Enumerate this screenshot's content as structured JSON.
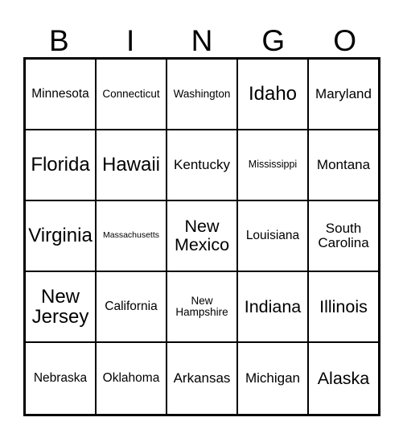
{
  "card": {
    "header": {
      "letters": [
        "B",
        "I",
        "N",
        "G",
        "O"
      ]
    },
    "rows": [
      [
        {
          "label": "Minnesota",
          "size": "m"
        },
        {
          "label": "Connecticut",
          "size": "s"
        },
        {
          "label": "Washington",
          "size": "s"
        },
        {
          "label": "Idaho",
          "size": "xxl"
        },
        {
          "label": "Maryland",
          "size": "ml"
        }
      ],
      [
        {
          "label": "Florida",
          "size": "xxl"
        },
        {
          "label": "Hawaii",
          "size": "xxl"
        },
        {
          "label": "Kentucky",
          "size": "ml"
        },
        {
          "label": "Mississippi",
          "size": "xs"
        },
        {
          "label": "Montana",
          "size": "ml"
        }
      ],
      [
        {
          "label": "Virginia",
          "size": "xxl"
        },
        {
          "label": "Massachusetts",
          "size": "xxs"
        },
        {
          "label": "New Mexico",
          "size": "xl"
        },
        {
          "label": "Louisiana",
          "size": "m"
        },
        {
          "label": "South Carolina",
          "size": "ml"
        }
      ],
      [
        {
          "label": "New Jersey",
          "size": "xxl"
        },
        {
          "label": "California",
          "size": "m"
        },
        {
          "label": "New Hampshire",
          "size": "s"
        },
        {
          "label": "Indiana",
          "size": "xl"
        },
        {
          "label": "Illinois",
          "size": "xl"
        }
      ],
      [
        {
          "label": "Nebraska",
          "size": "m"
        },
        {
          "label": "Oklahoma",
          "size": "m"
        },
        {
          "label": "Arkansas",
          "size": "ml"
        },
        {
          "label": "Michigan",
          "size": "ml"
        },
        {
          "label": "Alaska",
          "size": "xl"
        }
      ]
    ],
    "colors": {
      "border": "#000000",
      "text": "#000000",
      "cell_background": "#ffffff",
      "page_background": "#ffffff"
    }
  }
}
